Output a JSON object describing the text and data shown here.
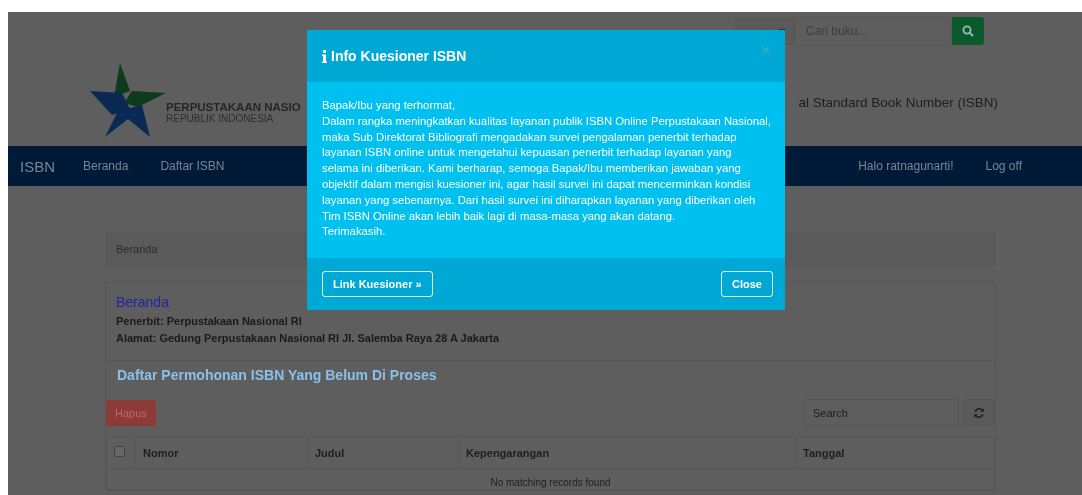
{
  "top_search": {
    "placeholder": "Cari buku..."
  },
  "header": {
    "org_name": "PERPUSTAKAAN NASIO",
    "org_sub": "REPUBLIK INDONESIA",
    "site_title": "al Standard Book Number (ISBN)"
  },
  "navbar": {
    "brand": "ISBN",
    "items": [
      "Beranda",
      "Daftar ISBN"
    ],
    "user": "Halo ratnagunarti!",
    "logout": "Log off"
  },
  "breadcrumb": [
    "Beranda"
  ],
  "profile": {
    "title": "Beranda",
    "lines": [
      "Penerbit: Perpustakaan Nasional RI",
      "Alamat: Gedung Perpustakaan Nasional RI Jl. Salemba Raya 28 A Jakarta"
    ]
  },
  "requests": {
    "title": "Daftar Permohonan ISBN Yang Belum Di Proses",
    "delete_button": "Hapus",
    "search": {
      "placeholder": "Search"
    },
    "select_all": {
      "checked": false
    },
    "columns": [
      "Nomor",
      "Judul",
      "Kepengarangan",
      "Tanggal"
    ],
    "empty_text": "No matching records found"
  },
  "modal": {
    "title": "Info Kuesioner ISBN",
    "greeting": "Bapak/Ibu yang terhormat,",
    "body": "Dalam rangka meningkatkan kualitas layanan publik ISBN Online Perpustakaan Nasional, maka Sub Direktorat Bibliografi mengadakan survei pengalaman penerbit terhadap layanan ISBN online untuk mengetahui kepuasan penerbit terhadap layanan yang selama ini diberikan. Kami berharap, semoga Bapak/Ibu memberikan jawaban yang objektif dalam mengisi kuesioner ini, agar hasil survei ini dapat mencerminkan kondisi layanan yang sebenarnya. Dari hasil survei ini diharapkan layanan yang diberikan oleh Tim ISBN Online akan lebih baik lagi di masa-masa yang akan datang.",
    "closing": "Terimakasih.",
    "link_button": "Link Kuesioner »",
    "close_button": "Close"
  }
}
